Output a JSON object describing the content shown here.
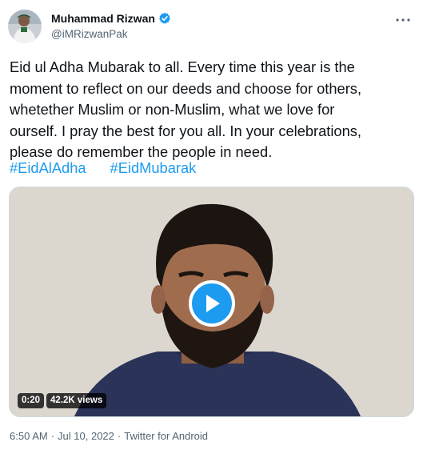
{
  "author": {
    "display_name": "Muhammad Rizwan",
    "handle": "@iMRizwanPak"
  },
  "icons": {
    "verified": "verified-badge-icon",
    "more": "more-horizontal-icon",
    "play": "play-icon"
  },
  "tweet": {
    "text_lines": [
      "Eid ul Adha Mubarak to all. Every time this year is the",
      "moment to reflect on our deeds and choose for others,",
      "whetether Muslim or non-Muslim, what we love for",
      "ourself. I pray the best for you all. In your celebrations,",
      "please do remember the people in need."
    ],
    "hashtags": [
      "#EidAlAdha",
      "#EidMubarak"
    ]
  },
  "video": {
    "duration": "0:20",
    "views": "42.2K views"
  },
  "meta": {
    "time": "6:50 AM",
    "separator": "·",
    "date": "Jul 10, 2022",
    "source": "Twitter for Android"
  },
  "colors": {
    "accent": "#1d9bf0",
    "text": "#0f1419",
    "secondary": "#536471"
  }
}
